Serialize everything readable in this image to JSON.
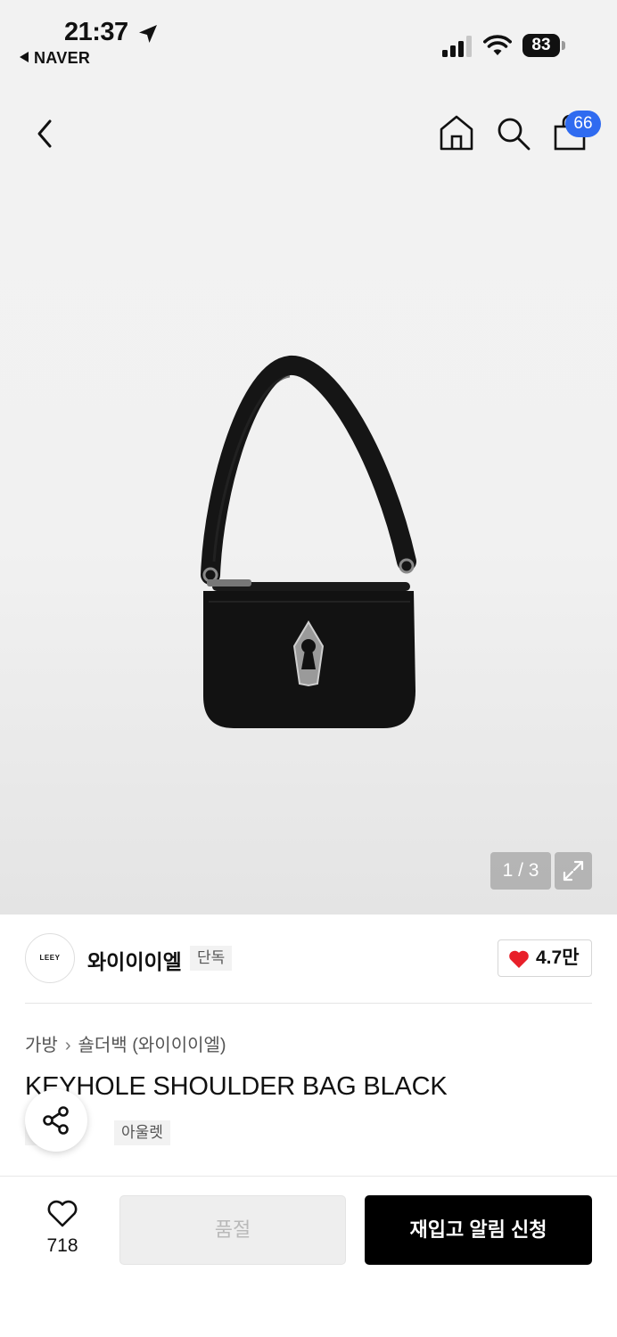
{
  "status_bar": {
    "time": "21:37",
    "back_app": "NAVER",
    "battery": "83"
  },
  "nav": {
    "cart_count": "66"
  },
  "gallery": {
    "pager": "1 / 3"
  },
  "brand": {
    "logo_text": "LEEY",
    "name": "와이이이엘",
    "tag": "단독",
    "likes": "4.7만"
  },
  "product": {
    "category": "가방",
    "subcategory": "숄더백 (와이이이엘)",
    "title": "KEYHOLE SHOULDER BAG BLACK",
    "tags": [
      "단독",
      "아울렛"
    ]
  },
  "bottom_bar": {
    "wish_count": "718",
    "soldout_label": "품절",
    "restock_label": "재입고 알림 신청"
  },
  "colors": {
    "accent_blue": "#2f6bf0",
    "heart_red": "#e8202a"
  }
}
